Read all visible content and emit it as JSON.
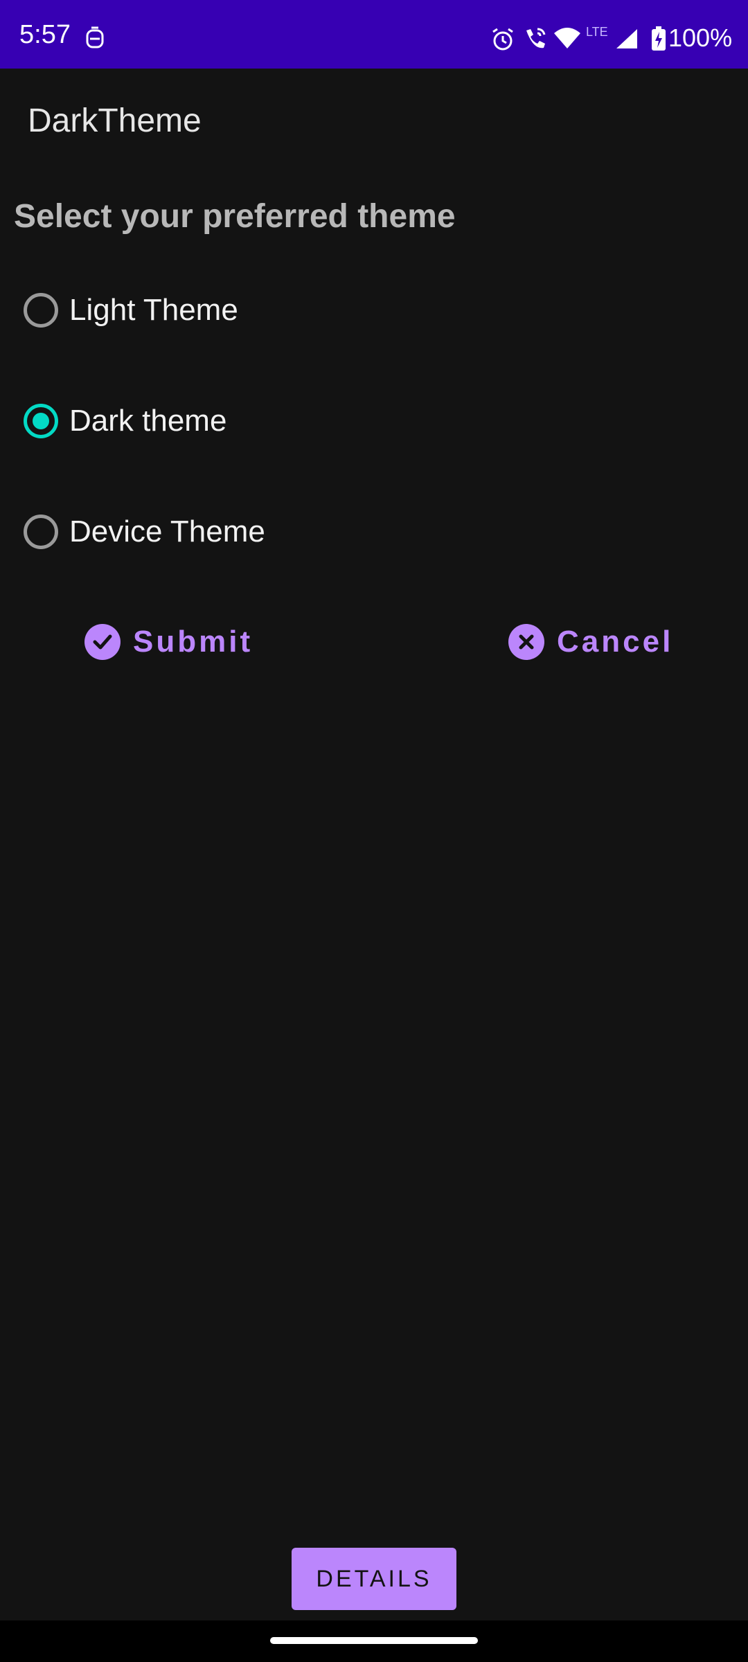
{
  "status_bar": {
    "time": "5:57",
    "battery": "100%",
    "network": "LTE",
    "icons": [
      "notification-icon",
      "alarm-icon",
      "wifi-call-icon",
      "wifi-icon",
      "signal-icon",
      "battery-icon"
    ]
  },
  "app": {
    "title": "DarkTheme"
  },
  "prompt": "Select your preferred theme",
  "options": [
    {
      "label": "Light Theme",
      "selected": false
    },
    {
      "label": "Dark theme",
      "selected": true
    },
    {
      "label": "Device Theme",
      "selected": false
    }
  ],
  "actions": {
    "submit_label": "Submit",
    "submit_icon": "check-circle-icon",
    "cancel_label": "Cancel",
    "cancel_icon": "close-circle-icon"
  },
  "details_label": "DETAILS",
  "colors": {
    "status_bar": "#3700b3",
    "background": "#131313",
    "accent": "#bb86fc",
    "radio_checked": "#03dac5"
  }
}
